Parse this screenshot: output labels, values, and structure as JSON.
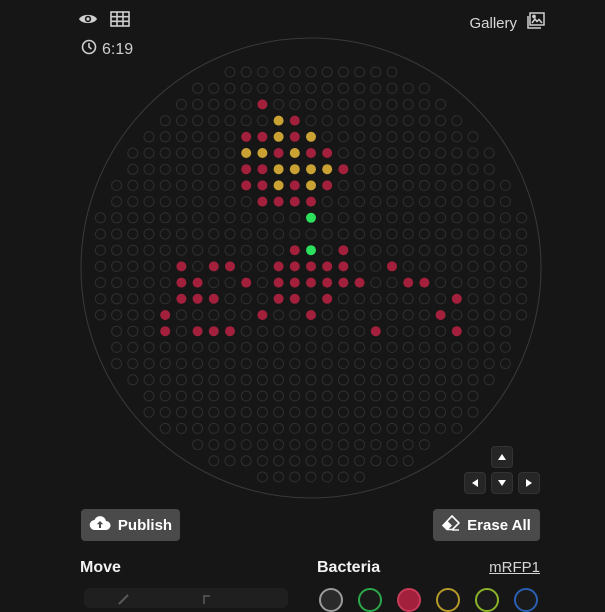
{
  "header": {
    "timer": "6:19",
    "gallery_label": "Gallery"
  },
  "icons": {
    "eye": "eye-icon",
    "grid": "grid-icon",
    "clock": "clock-icon",
    "gallery": "gallery-icon",
    "cloud_upload": "cloud-upload-icon",
    "eraser": "eraser-icon"
  },
  "actions": {
    "publish_label": "Publish",
    "erase_label": "Erase All"
  },
  "sections": {
    "move_title": "Move",
    "bacteria_title": "Bacteria",
    "selected_bacteria": "mRFP1"
  },
  "colors": {
    "background": "#161616",
    "empty_well": "#2f2f2f",
    "mRFP1": "#a3203d",
    "yellow": "#c9a233",
    "green": "#2ce05d"
  },
  "palette": [
    {
      "name": "none",
      "color": "#2a2a2a",
      "ring": "#9a9a9a"
    },
    {
      "name": "green",
      "color": "#1a1a1a",
      "ring": "#2ca84a"
    },
    {
      "name": "mRFP1",
      "color": "#a3203d",
      "ring": "#c73a58"
    },
    {
      "name": "yellow",
      "color": "#1a1a1a",
      "ring": "#b59a2a"
    },
    {
      "name": "lime",
      "color": "#1a1a1a",
      "ring": "#8ab32a"
    },
    {
      "name": "blue",
      "color": "#1a1a1a",
      "ring": "#2a5fb3"
    }
  ],
  "plate": {
    "cols": 27,
    "rows": 26,
    "pattern": [
      "...........................",
      "...........................",
      "..........R................",
      "...........YR..............",
      ".........RRYRY.............",
      ".........YYRYRR............",
      ".........RRYYYYR...........",
      ".........RRYRYR............",
      "..........RRRR.............",
      ".............G.............",
      "...........................",
      "............RG.R...........",
      ".....R.RR..RRRRR..R........",
      ".....RR..R.RRRRRR..RR......",
      ".....RRR...RR.R.......R....",
      "....R.....R..R.......R.....",
      "....R.RRR........R....R....",
      "...........................",
      "...........................",
      "...........................",
      "...........................",
      "...........................",
      "...........................",
      "...........................",
      "...........................",
      "..........................."
    ]
  }
}
